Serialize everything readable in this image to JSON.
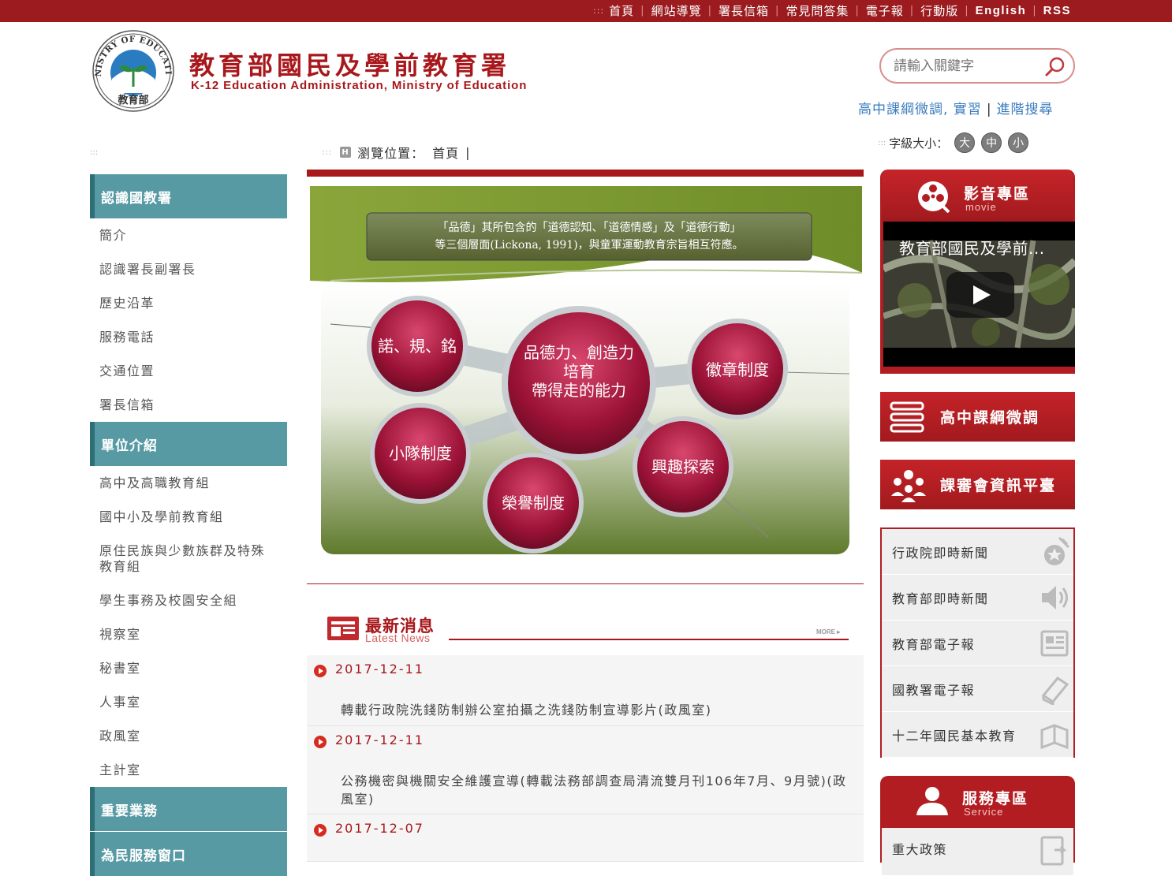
{
  "top_nav": {
    "dots": ":::",
    "items": [
      "首頁",
      "網站導覽",
      "署長信箱",
      "常見問答集",
      "電子報",
      "行動版",
      "English",
      "RSS"
    ]
  },
  "header": {
    "title": "教育部國民及學前教育署",
    "subtitle": "K-12 Education Administration, Ministry of Education",
    "seal_text": "MINISTRY OF EDUCATION",
    "seal_cn": "教育部"
  },
  "search": {
    "placeholder": "請輸入關鍵字"
  },
  "quick_links": {
    "a": "高中課綱微調, 實習",
    "sep": "|",
    "b": "進階搜尋"
  },
  "font_size": {
    "dots": ":::",
    "label": "字級大小：",
    "large": "大",
    "medium": "中",
    "small": "小"
  },
  "left_dots": ":::",
  "breadcrumb": {
    "dots": ":::",
    "h": "H",
    "label": "瀏覽位置：",
    "home": "首頁",
    "sep": "|"
  },
  "sidebar": [
    {
      "title": "認識國教署",
      "items": [
        "簡介",
        "認識署長副署長",
        "歷史沿革",
        "服務電話",
        "交通位置",
        "署長信箱"
      ]
    },
    {
      "title": "單位介紹",
      "items": [
        "高中及高職教育組",
        "國中小及學前教育組",
        "原住民族與少數族群及特殊教育組",
        "學生事務及校園安全組",
        "視察室",
        "秘書室",
        "人事室",
        "政風室",
        "主計室"
      ]
    },
    {
      "title": "重要業務",
      "items": []
    },
    {
      "title": "為民服務窗口",
      "items": []
    }
  ],
  "banner": {
    "quote_line1": "「品德」其所包含的「道德認知、「道德情感」及「道德行動」",
    "quote_line2": "等三個層面(Lickona, 1991)，與童軍運動教育宗旨相互符應。",
    "center_line1": "品德力、創造力",
    "center_line2": "培育",
    "center_line3": "帶得走的能力",
    "nodes": [
      "諾、規、銘",
      "徽章制度",
      "小隊制度",
      "興趣探索",
      "榮譽制度"
    ]
  },
  "news": {
    "title": "最新消息",
    "subtitle": "Latest News",
    "more": "MORE",
    "items": [
      {
        "date": "2017-12-11",
        "text": "轉載行政院洗錢防制辦公室拍攝之洗錢防制宣導影片(政風室)"
      },
      {
        "date": "2017-12-11",
        "text": "公務機密與機關安全維護宣導(轉載法務部調查局清流雙月刊106年7月、9月號)(政風室)"
      },
      {
        "date": "2017-12-07",
        "text": ""
      }
    ]
  },
  "video": {
    "title": "影音專區",
    "subtitle": "movie",
    "caption": "教育部國民及學前..."
  },
  "promos": [
    "高中課綱微調",
    "課審會資訊平臺"
  ],
  "links": [
    {
      "label": "行政院即時新聞",
      "icon": "news-flash-icon"
    },
    {
      "label": "教育部即時新聞",
      "icon": "speaker-icon"
    },
    {
      "label": "教育部電子報",
      "icon": "newspaper-icon"
    },
    {
      "label": "國教署電子報",
      "icon": "book-icon"
    },
    {
      "label": "十二年國民基本教育",
      "icon": "open-book-icon"
    }
  ],
  "service": {
    "title": "服務專區",
    "subtitle": "Service",
    "first": "重大政策"
  },
  "colors": {
    "brand_red": "#a8171b",
    "teal": "#579aa3",
    "link_blue": "#3a7bbf"
  }
}
